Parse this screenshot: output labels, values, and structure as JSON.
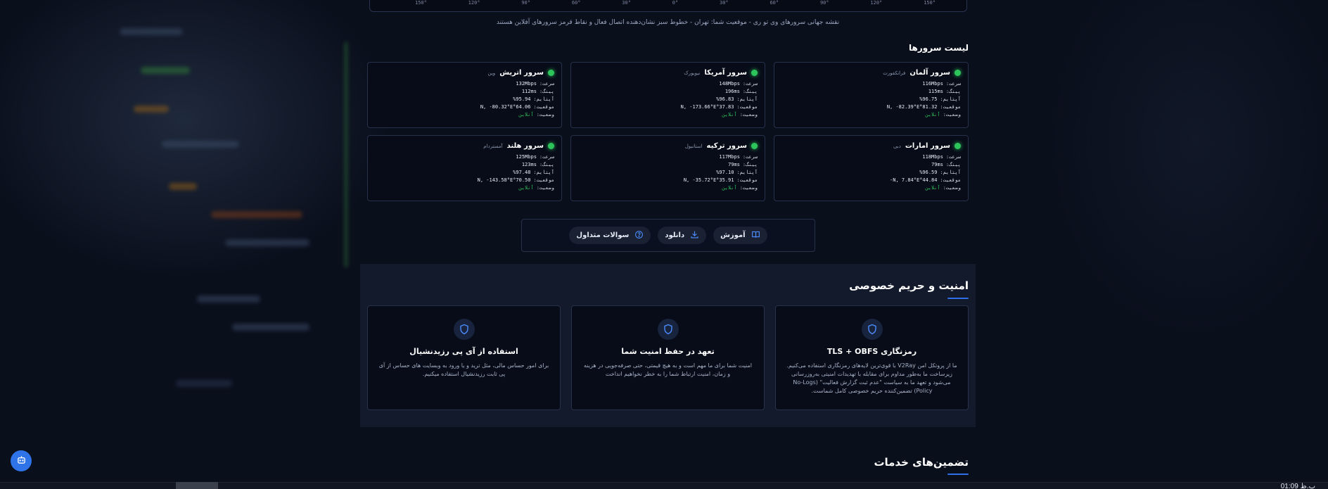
{
  "map": {
    "ticks": [
      "150°",
      "120°",
      "90°",
      "60°",
      "30°",
      "0°",
      "30°",
      "60°",
      "90°",
      "120°",
      "150°"
    ],
    "caption": "نقشه جهانی سرورهای وی تو ری - موقعیت شما: تهران - خطوط سبز نشان‌دهنده اتصال فعال و نقاط قرمز سرورهای آفلاین هستند"
  },
  "servers": {
    "title": "لیست سرورها",
    "labels": {
      "speed": "سرعت:",
      "ping": "پینگ:",
      "uptime": "آپتایم:",
      "location": "موقعیت:",
      "status": "وضعیت:"
    },
    "items": [
      {
        "name": "سرور آلمان",
        "city": "فرانکفورت",
        "speed": "116Mbps",
        "ping": "115ms",
        "uptime": "%96.75",
        "location": "N, -82.39°E°81.32",
        "status": "آنلاین"
      },
      {
        "name": "سرور آمریکا",
        "city": "نیویورک",
        "speed": "148Mbps",
        "ping": "196ms",
        "uptime": "%96.83",
        "location": "N, -173.66°E°37.83",
        "status": "آنلاین"
      },
      {
        "name": "سرور اتریش",
        "city": "وین",
        "speed": "132Mbps",
        "ping": "112ms",
        "uptime": "%95.94",
        "location": "N, -80.32°E°64.06",
        "status": "آنلاین"
      },
      {
        "name": "سرور امارات",
        "city": "دبی",
        "speed": "118Mbps",
        "ping": "79ms",
        "uptime": "%96.59",
        "location": "N, 7.84°E°44.84-",
        "status": "آنلاین"
      },
      {
        "name": "سرور ترکیه",
        "city": "استانبول",
        "speed": "117Mbps",
        "ping": "79ms",
        "uptime": "%97.10",
        "location": "N, -35.72°E°35.91",
        "status": "آنلاین"
      },
      {
        "name": "سرور هلند",
        "city": "آمستردام",
        "speed": "125Mbps",
        "ping": "123ms",
        "uptime": "%97.48",
        "location": "N, -143.58°E°70.50",
        "status": "آنلاین"
      }
    ],
    "status_color": "#2ec45c"
  },
  "actions": {
    "tutorial": "آموزش",
    "download": "دانلود",
    "faq": "سوالات متداول"
  },
  "security": {
    "title": "امنیت و حریم خصوصی",
    "cards": [
      {
        "title": "رمزنگاری TLS + OBFS",
        "desc": "ما از پروتکل امن V2Ray با قوی‌ترین لایه‌های رمزنگاری استفاده می‌کنیم. زیرساخت ما به‌طور مداوم برای مقابله با تهدیدات امنیتی به‌روزرسانی می‌شود و تعهد ما به سیاست \"عدم ثبت گزارش فعالیت\" (No-Logs Policy) تضمین‌کننده حریم خصوصی کامل شماست."
      },
      {
        "title": "تعهد در حفظ امنیت شما",
        "desc": "امنیت شما برای ما مهم است و به هیچ قیمتی، حتی صرفه‌جویی در هزینه و زمان، امنیت ارتباط شما را به خطر نخواهیم انداخت"
      },
      {
        "title": "استفاده از آی پی رزیدنشیال",
        "desc": "برای امور حساس مالی، مثل ترید و یا ورود به وبسایت های حساس از آی پی ثابت رزیدنشیال استفاده میکنیم."
      }
    ]
  },
  "services": {
    "title": "تضمین‌های خدمات"
  },
  "taskbar": {
    "clock": "01:09 ب.ظ"
  },
  "colors": {
    "accent": "#2f73e8",
    "background": "#0a0f1c",
    "online": "#2ec45c"
  }
}
